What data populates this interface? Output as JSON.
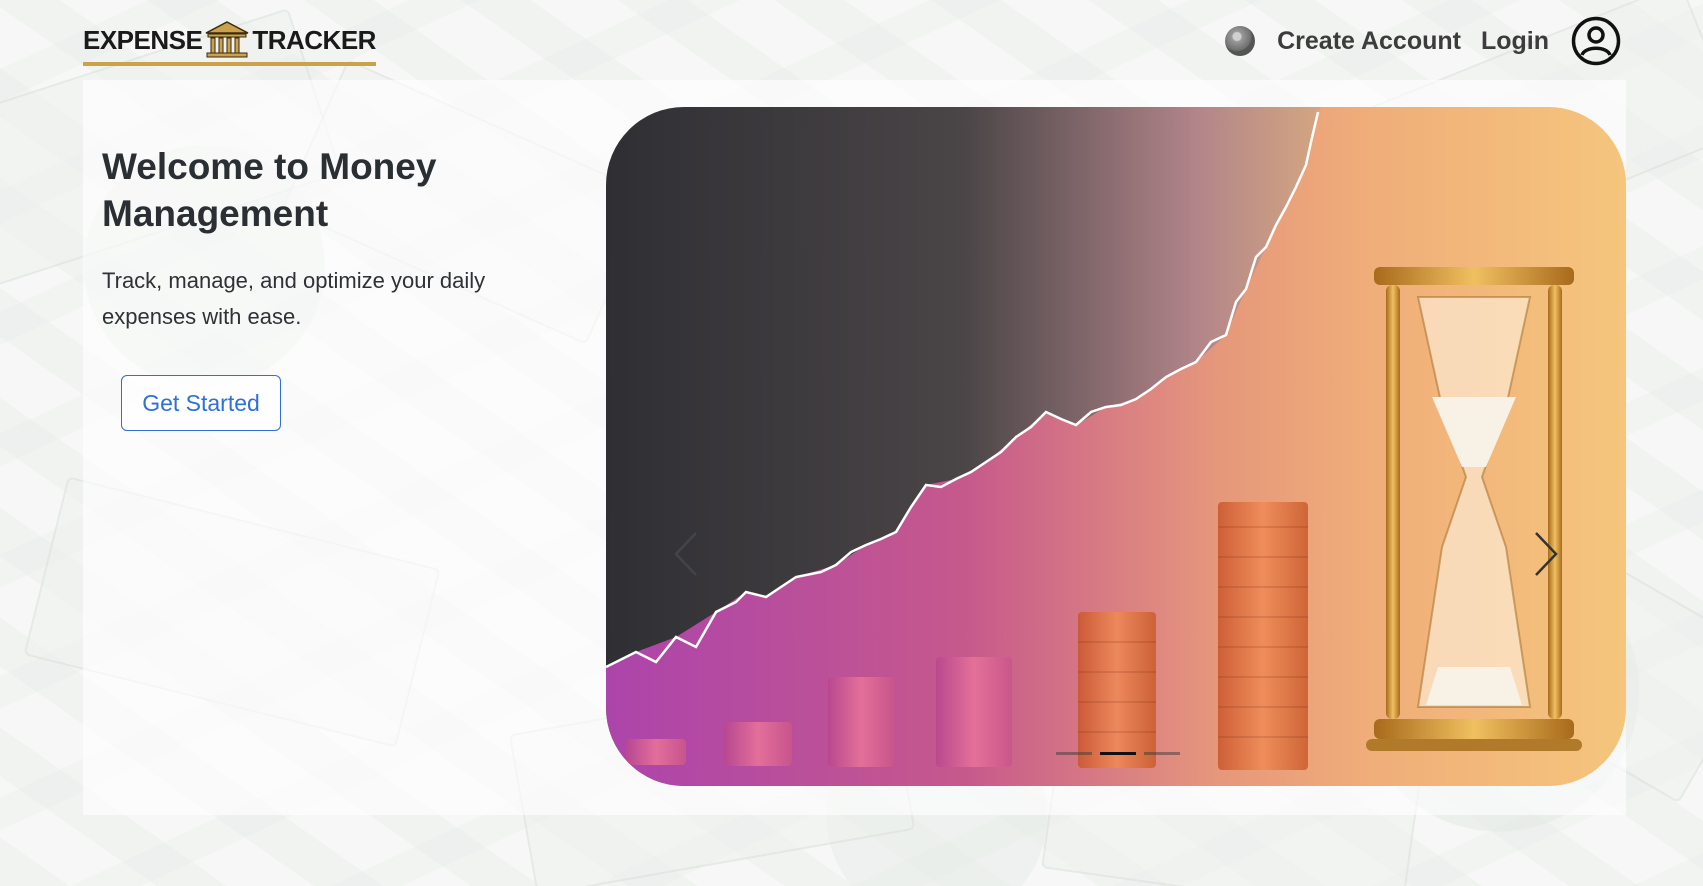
{
  "header": {
    "logo": {
      "left_word": "EXPENSE",
      "right_word": "TRACKER",
      "icon": "bank-icon",
      "accent": "#c9a24b"
    },
    "theme_toggle_icon": "moon-icon",
    "nav": {
      "create_account": "Create Account",
      "login": "Login",
      "user_icon": "user-circle-icon"
    }
  },
  "hero": {
    "title": "Welcome to Money Management",
    "tagline": "Track, manage, and optimize your daily expenses with ease.",
    "cta": "Get Started"
  },
  "carousel": {
    "slide_count": 3,
    "active_index": 1,
    "prev_icon": "chevron-left-icon",
    "next_icon": "chevron-right-icon"
  },
  "colors": {
    "cta": "#2e6fd9",
    "nav_text": "#3c3c3c",
    "title_text": "#2a2f33"
  }
}
